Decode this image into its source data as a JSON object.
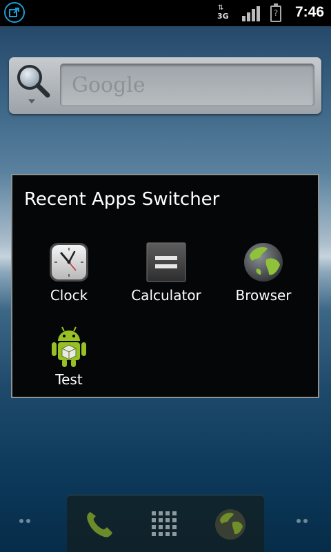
{
  "status_bar": {
    "network_type": "3G",
    "network_arrows": "⇅",
    "battery_indicator": "?",
    "time": "7:46",
    "icons": [
      "notification-icon",
      "network-3g-icon",
      "signal-icon",
      "battery-icon"
    ]
  },
  "search_widget": {
    "placeholder": "Google",
    "icon": "search-icon"
  },
  "recent_apps_dialog": {
    "title": "Recent Apps Switcher",
    "apps": [
      {
        "label": "Clock",
        "icon": "clock-icon"
      },
      {
        "label": "Calculator",
        "icon": "calculator-icon"
      },
      {
        "label": "Browser",
        "icon": "browser-icon"
      },
      {
        "label": "Test",
        "icon": "android-icon"
      }
    ]
  },
  "dock": {
    "items": [
      {
        "icon": "phone-icon"
      },
      {
        "icon": "app-drawer-icon"
      },
      {
        "icon": "browser-icon"
      }
    ]
  },
  "colors": {
    "accent": "#1b9fd4",
    "dialog_bg": "#050607",
    "dialog_border": "#8e9396",
    "android_green": "#97c024"
  }
}
